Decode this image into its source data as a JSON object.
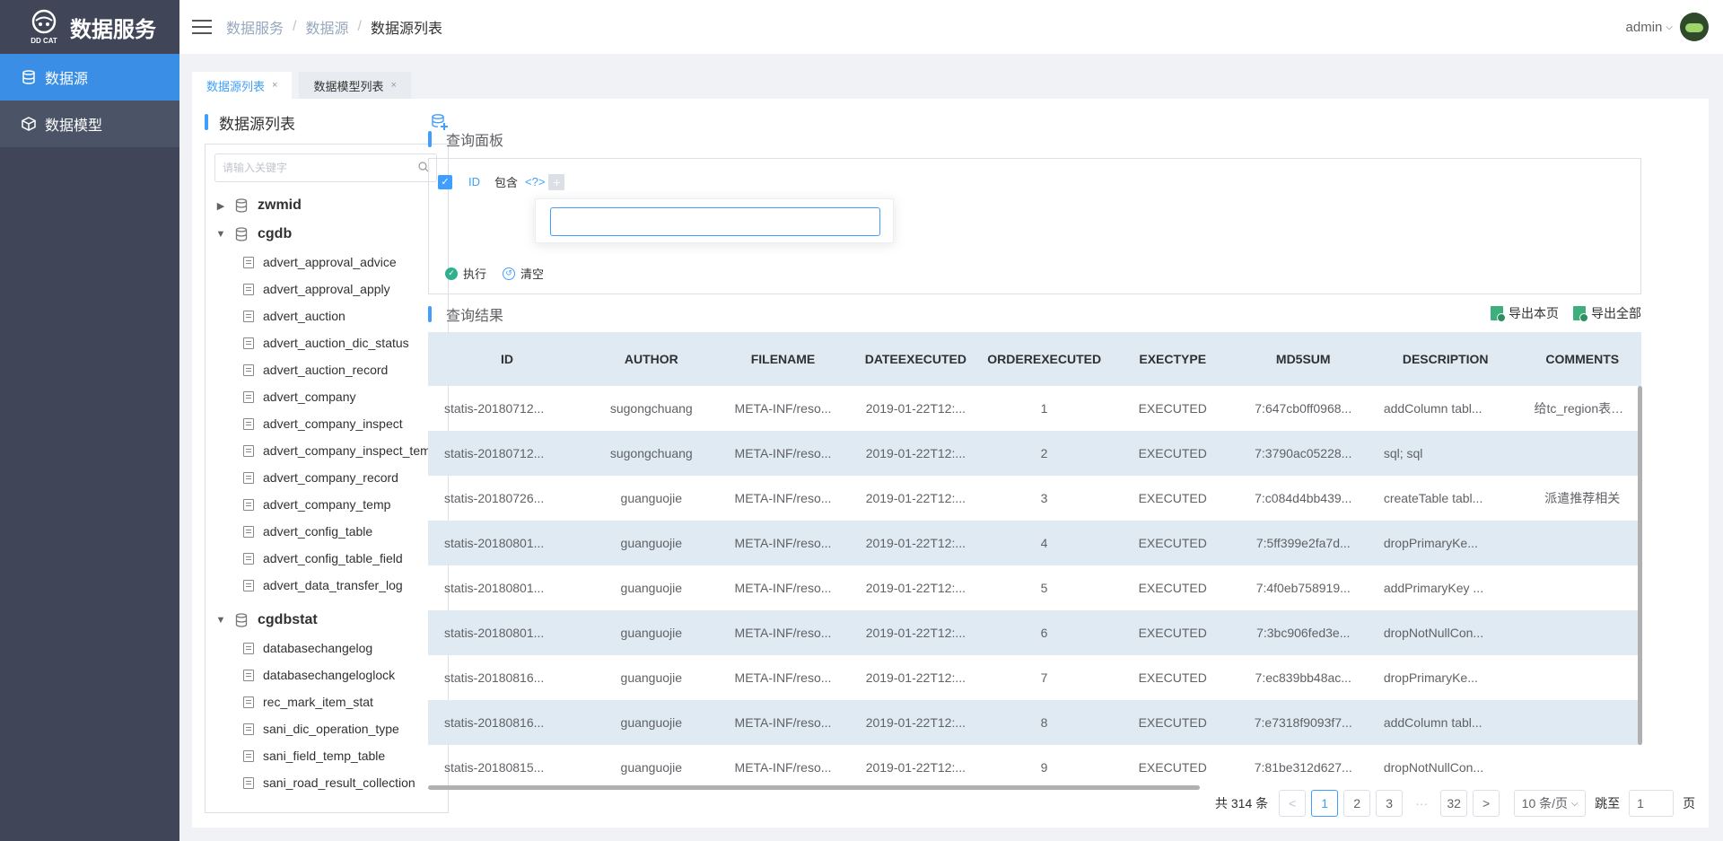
{
  "app": {
    "logo_text": "DD CAT",
    "title": "数据服务"
  },
  "sidebar": {
    "items": [
      {
        "label": "数据源"
      },
      {
        "label": "数据模型"
      }
    ]
  },
  "header": {
    "breadcrumbs": [
      "数据服务",
      "数据源",
      "数据源列表"
    ],
    "separator": "/",
    "user": "admin"
  },
  "tabs": [
    {
      "label": "数据源列表"
    },
    {
      "label": "数据模型列表"
    }
  ],
  "datasource_panel": {
    "title": "数据源列表",
    "search_placeholder": "请输入关键字",
    "tree": [
      {
        "name": "zwmid",
        "expanded": false,
        "tables": []
      },
      {
        "name": "cgdb",
        "expanded": true,
        "tables": [
          "advert_approval_advice",
          "advert_approval_apply",
          "advert_auction",
          "advert_auction_dic_status",
          "advert_auction_record",
          "advert_company",
          "advert_company_inspect",
          "advert_company_inspect_temp",
          "advert_company_record",
          "advert_company_temp",
          "advert_config_table",
          "advert_config_table_field",
          "advert_data_transfer_log"
        ]
      },
      {
        "name": "cgdbstat",
        "expanded": true,
        "tables": [
          "databasechangelog",
          "databasechangeloglock",
          "rec_mark_item_stat",
          "sani_dic_operation_type",
          "sani_field_temp_table",
          "sani_road_result_collection"
        ]
      }
    ]
  },
  "query_panel": {
    "title": "查询面板",
    "condition": {
      "field": "ID",
      "operator": "包含",
      "value": "<?>",
      "add": "+"
    },
    "input_value": "",
    "execute_label": "执行",
    "clear_label": "清空"
  },
  "results": {
    "title": "查询结果",
    "export_page_label": "导出本页",
    "export_all_label": "导出全部",
    "columns": [
      "ID",
      "AUTHOR",
      "FILENAME",
      "DATEEXECUTED",
      "ORDEREXECUTED",
      "EXECTYPE",
      "MD5SUM",
      "DESCRIPTION",
      "COMMENTS"
    ],
    "rows": [
      [
        "statis-20180712...",
        "sugongchuang",
        "META-INF/reso...",
        "2019-01-22T12:...",
        "1",
        "EXECUTED",
        "7:647cb0ff0968...",
        "addColumn tabl...",
        "给tc_region表新..."
      ],
      [
        "statis-20180712...",
        "sugongchuang",
        "META-INF/reso...",
        "2019-01-22T12:...",
        "2",
        "EXECUTED",
        "7:3790ac05228...",
        "sql; sql",
        ""
      ],
      [
        "statis-20180726...",
        "guanguojie",
        "META-INF/reso...",
        "2019-01-22T12:...",
        "3",
        "EXECUTED",
        "7:c084d4bb439...",
        "createTable tabl...",
        "派遣推荐相关"
      ],
      [
        "statis-20180801...",
        "guanguojie",
        "META-INF/reso...",
        "2019-01-22T12:...",
        "4",
        "EXECUTED",
        "7:5ff399e2fa7d...",
        "dropPrimaryKe...",
        ""
      ],
      [
        "statis-20180801...",
        "guanguojie",
        "META-INF/reso...",
        "2019-01-22T12:...",
        "5",
        "EXECUTED",
        "7:4f0eb758919...",
        "addPrimaryKey ...",
        ""
      ],
      [
        "statis-20180801...",
        "guanguojie",
        "META-INF/reso...",
        "2019-01-22T12:...",
        "6",
        "EXECUTED",
        "7:3bc906fed3e...",
        "dropNotNullCon...",
        ""
      ],
      [
        "statis-20180816...",
        "guanguojie",
        "META-INF/reso...",
        "2019-01-22T12:...",
        "7",
        "EXECUTED",
        "7:ec839bb48ac...",
        "dropPrimaryKe...",
        ""
      ],
      [
        "statis-20180816...",
        "guanguojie",
        "META-INF/reso...",
        "2019-01-22T12:...",
        "8",
        "EXECUTED",
        "7:e7318f9093f7...",
        "addColumn tabl...",
        ""
      ],
      [
        "statis-20180815...",
        "guanguojie",
        "META-INF/reso...",
        "2019-01-22T12:...",
        "9",
        "EXECUTED",
        "7:81be312d627...",
        "dropNotNullCon...",
        ""
      ]
    ]
  },
  "pagination": {
    "total_label": "共 314 条",
    "pages": [
      "1",
      "2",
      "3"
    ],
    "ellipsis": "···",
    "last_page": "32",
    "current": "1",
    "prev": "<",
    "next": ">",
    "page_size": "10 条/页",
    "jump_label": "跳至",
    "jump_value": "1",
    "page_suffix": "页"
  },
  "colors": {
    "accent": "#409eff",
    "sidebar_bg": "#404658",
    "row_alt": "#dfeaf2"
  }
}
